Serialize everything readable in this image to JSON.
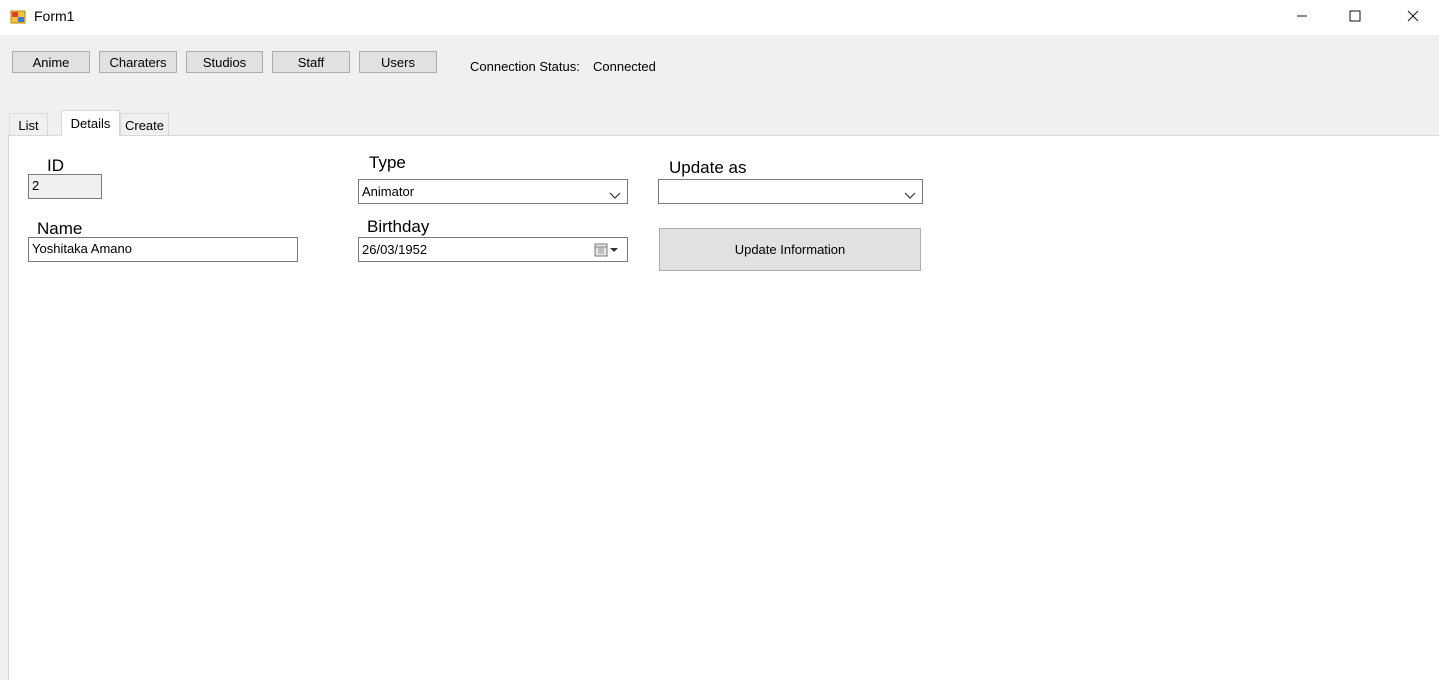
{
  "window": {
    "title": "Form1",
    "controls": [
      "minimize-icon",
      "maximize-icon",
      "close-icon"
    ]
  },
  "nav": {
    "buttons": [
      "Anime",
      "Charaters",
      "Studios",
      "Staff",
      "Users"
    ]
  },
  "connection": {
    "label": "Connection Status:",
    "value": "Connected"
  },
  "tabs": [
    "List",
    "Details",
    "Create"
  ],
  "active_tab": "Details",
  "form": {
    "id_label": "ID",
    "id_value": "2",
    "name_label": "Name",
    "name_value": "Yoshitaka Amano",
    "type_label": "Type",
    "type_value": "Animator",
    "birthday_label": "Birthday",
    "birthday_value": "26/03/1952",
    "update_as_label": "Update as",
    "update_as_value": "",
    "update_button": "Update Information"
  },
  "colors": {
    "window_bg": "#f0f0f0",
    "panel_bg": "#ffffff",
    "button_bg": "#e1e1e1",
    "border": "#adadad"
  }
}
